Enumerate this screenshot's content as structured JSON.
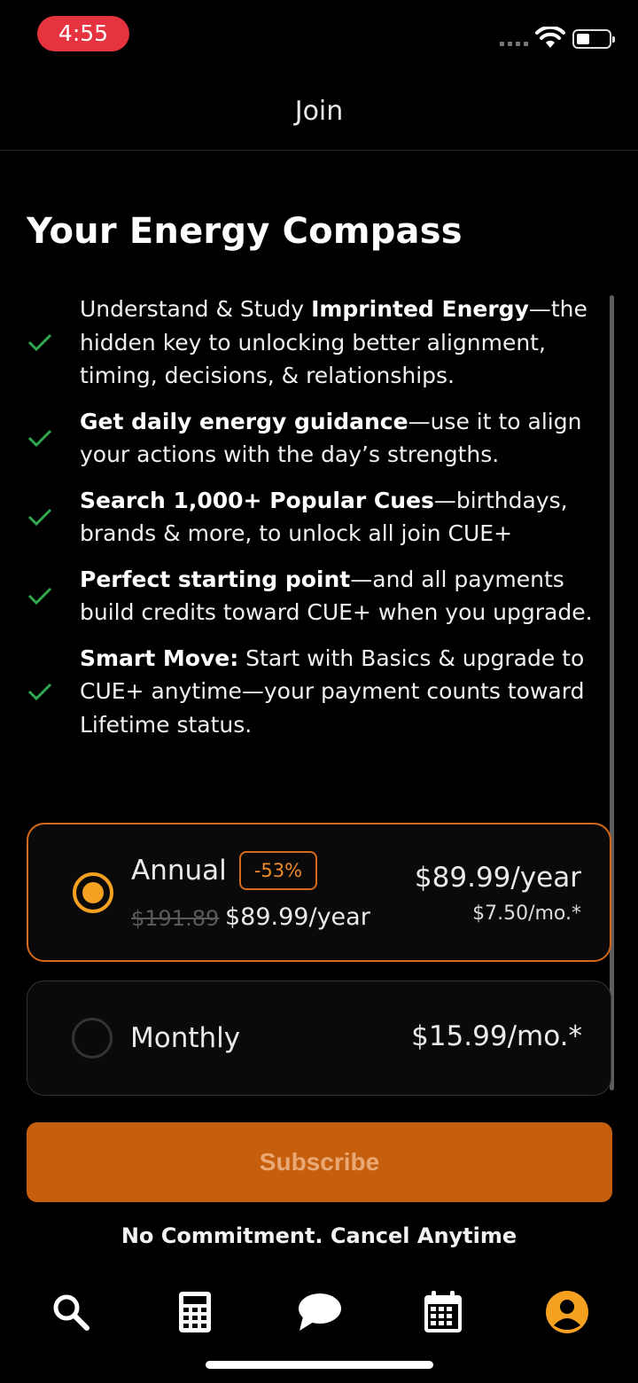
{
  "status_bar": {
    "time": "4:55",
    "time_pill_color": "#e5343f"
  },
  "header": {
    "title": "Join"
  },
  "page": {
    "title": "Your Energy Compass"
  },
  "features": [
    {
      "bold": "",
      "pre": "Understand & Study ",
      "bold_mid": "Imprinted Energy",
      "rest": "—the hidden key to unlocking better alignment, timing, decisions, & relationships."
    },
    {
      "pre": "",
      "bold_mid": "Get daily energy guidance",
      "rest": "—use it to align your actions with the day’s strengths."
    },
    {
      "pre": "",
      "bold_mid": "Search 1,000+ Popular Cues",
      "rest": "—birthdays, brands & more, to unlock all join CUE+"
    },
    {
      "pre": "",
      "bold_mid": "Perfect starting point",
      "rest": "—and all payments build credits toward CUE+ when you upgrade."
    },
    {
      "pre": "",
      "bold_mid": "Smart Move:",
      "rest": " Start with Basics & upgrade to CUE+ anytime—your payment counts toward Lifetime status."
    }
  ],
  "plans": {
    "annual": {
      "name": "Annual",
      "discount": "-53%",
      "old_price": "$191.89",
      "new_price": "$89.99/year",
      "price": "$89.99/year",
      "per_month": "$7.50/mo.*",
      "selected": true
    },
    "monthly": {
      "name": "Monthly",
      "price": "$15.99/mo.*",
      "selected": false
    }
  },
  "subscribe": {
    "label": "Subscribe"
  },
  "footer_note": "No Commitment. Cancel Anytime",
  "tabbar": {
    "items": [
      {
        "icon": "search-icon"
      },
      {
        "icon": "calculator-icon"
      },
      {
        "icon": "chat-icon"
      },
      {
        "icon": "calendar-icon"
      },
      {
        "icon": "profile-icon",
        "active": true
      }
    ]
  },
  "colors": {
    "accent": "#f4a020",
    "button": "#c55f0e",
    "check": "#2fa84f"
  }
}
